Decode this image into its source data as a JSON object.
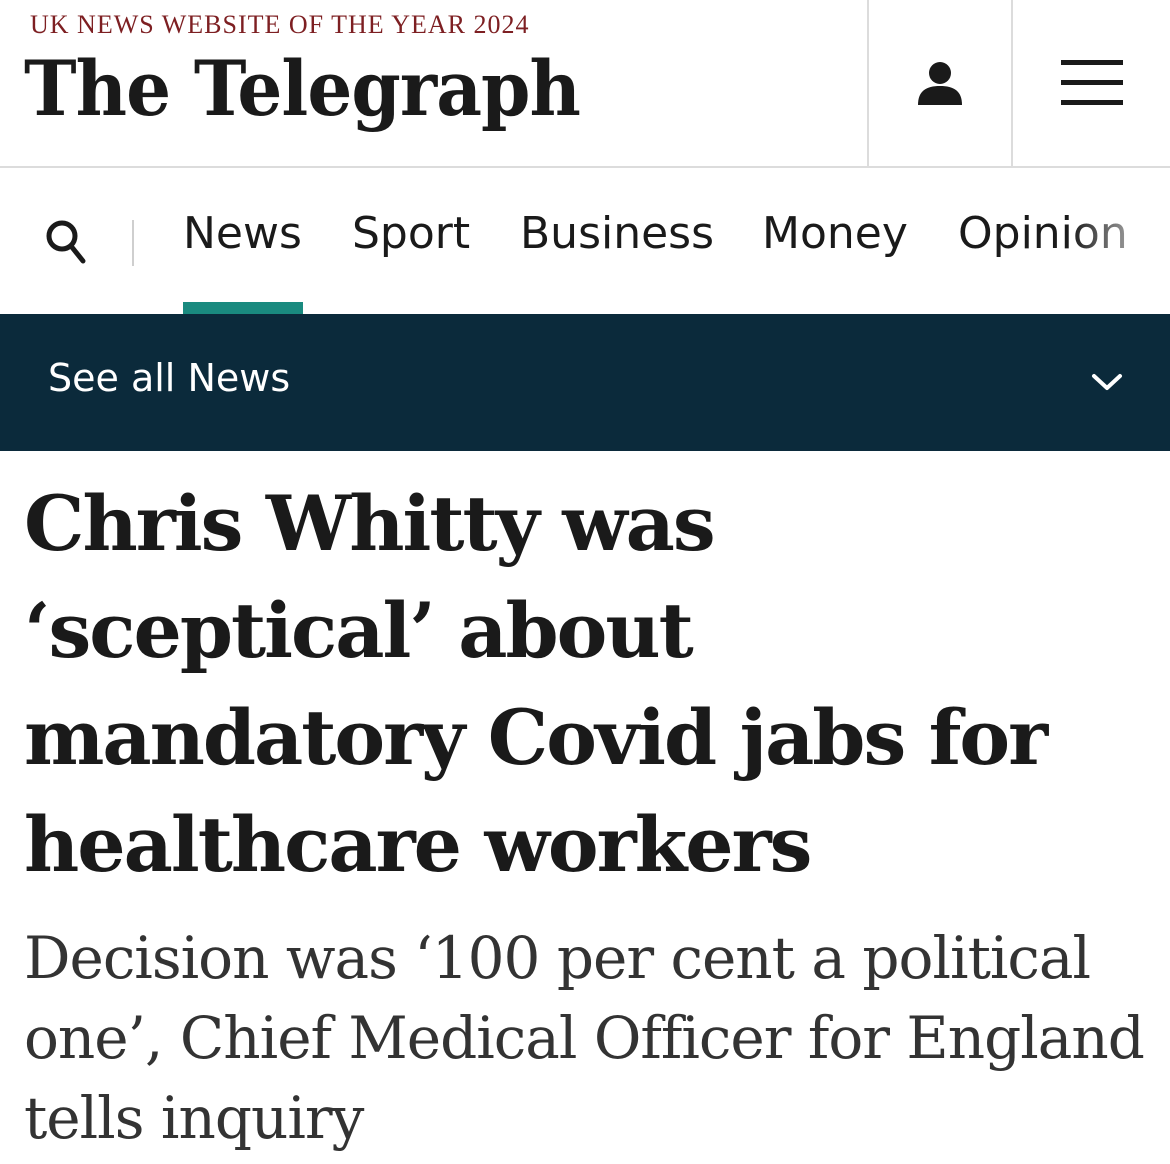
{
  "masthead": {
    "award": "UK NEWS WEBSITE OF THE YEAR 2024",
    "logo": "The Telegraph",
    "account_icon": "person-icon",
    "menu_icon": "hamburger-menu-icon"
  },
  "nav": {
    "search_icon": "search-icon",
    "items": [
      {
        "label": "News",
        "active": true
      },
      {
        "label": "Sport",
        "active": false
      },
      {
        "label": "Business",
        "active": false
      },
      {
        "label": "Money",
        "active": false
      },
      {
        "label": "Opinion",
        "active": false
      }
    ],
    "active_color": "#1a8a7f"
  },
  "subnav": {
    "label": "See all News",
    "chevron_icon": "chevron-down-icon",
    "background": "#0b2a3b"
  },
  "article": {
    "headline": "Chris Whitty was ‘sceptical’ about mandatory Covid jabs for healthcare workers",
    "standfirst": "Decision was ‘100 per cent a political one’, Chief Medical Officer for England tells inquiry"
  },
  "colors": {
    "award_text": "#7d1f22",
    "text": "#1a1a1a"
  }
}
